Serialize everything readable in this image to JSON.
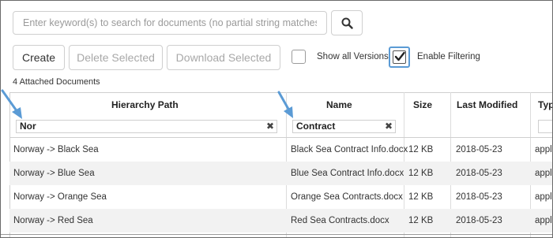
{
  "search": {
    "placeholder": "Enter keyword(s) to search for documents (no partial string matches)...",
    "button_icon": "search-icon"
  },
  "actions": {
    "create_label": "Create",
    "delete_selected_label": "Delete Selected",
    "download_selected_label": "Download Selected",
    "show_all_versions_label": "Show all Versions",
    "show_all_versions_checked": false,
    "enable_filtering_label": "Enable Filtering",
    "enable_filtering_checked": true
  },
  "attached_count_text": "4 Attached Documents",
  "table": {
    "columns": [
      "Hierarchy Path",
      "Name",
      "Size",
      "Last Modified",
      "Typ"
    ],
    "filters": {
      "hierarchy_path": "Nor",
      "name": "Contract"
    },
    "rows": [
      {
        "path": "Norway -> Black Sea",
        "name": "Black Sea Contract Info.docx",
        "size": "12 KB",
        "modified": "2018-05-23",
        "type": "appli"
      },
      {
        "path": "Norway -> Blue Sea",
        "name": "Blue Sea Contract Info.docx",
        "size": "12 KB",
        "modified": "2018-05-23",
        "type": "appli"
      },
      {
        "path": "Norway -> Orange Sea",
        "name": "Orange Sea Contracts.docx",
        "size": "12 KB",
        "modified": "2018-05-23",
        "type": "appli"
      },
      {
        "path": "Norway -> Red Sea",
        "name": "Red Sea Contracts.docx",
        "size": "12 KB",
        "modified": "2018-05-23",
        "type": "appli"
      }
    ]
  },
  "annotation": {
    "arrow_color": "#5b9bd5"
  },
  "colors": {
    "focus_border": "#5b9bd5",
    "row_alt": "#f2f2f2"
  }
}
